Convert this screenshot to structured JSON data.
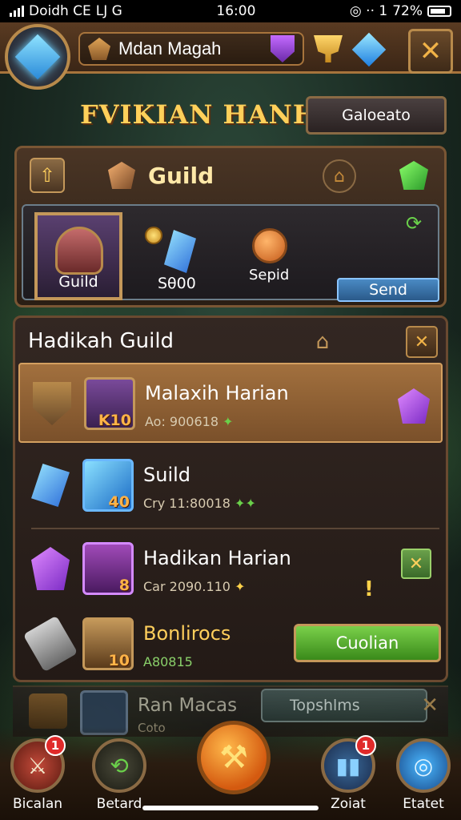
{
  "status_bar": {
    "carrier": "Doidh CE",
    "extra": "LJ G",
    "time": "16:00",
    "battery": "72%",
    "signal_icons": "◎ ·· 1"
  },
  "header": {
    "player_name": "Mdan Magah",
    "title": "FVIKIAN HANHIH",
    "top_right_button": "Galoeato"
  },
  "guild_panel": {
    "label": "Guild",
    "hero_label": "Guild",
    "stat_a": "Sθ00",
    "stat_b": "Sepid",
    "send_button": "Send"
  },
  "list": {
    "title": "Hadikah Guild",
    "rows": [
      {
        "name": "Malaxih Harian",
        "sub": "Ao: 900618",
        "level": "K10"
      },
      {
        "name": "Suild",
        "sub": "Cry 11:80018",
        "level": "40"
      },
      {
        "name": "Hadikan Harian",
        "sub": "Car 2090.110",
        "level": "8"
      },
      {
        "name": "Bonlirocs",
        "sub": "A80815",
        "level": "10",
        "button": "Cuolian"
      }
    ],
    "ghost_row": {
      "name": "Ran Macas",
      "sub": "Coto",
      "button": "Topshlms"
    }
  },
  "bottom_nav": [
    {
      "label": "Bicalan",
      "badge": "1"
    },
    {
      "label": "Betard",
      "badge": ""
    },
    {
      "label": "Zoiat",
      "badge": "1"
    },
    {
      "label": "Etatet",
      "badge": ""
    }
  ],
  "colors": {
    "accent_gold": "#ffd05a",
    "panel_brown": "#4a3525",
    "confirm_green": "#5aa02a",
    "badge_red": "#e02a2a"
  }
}
